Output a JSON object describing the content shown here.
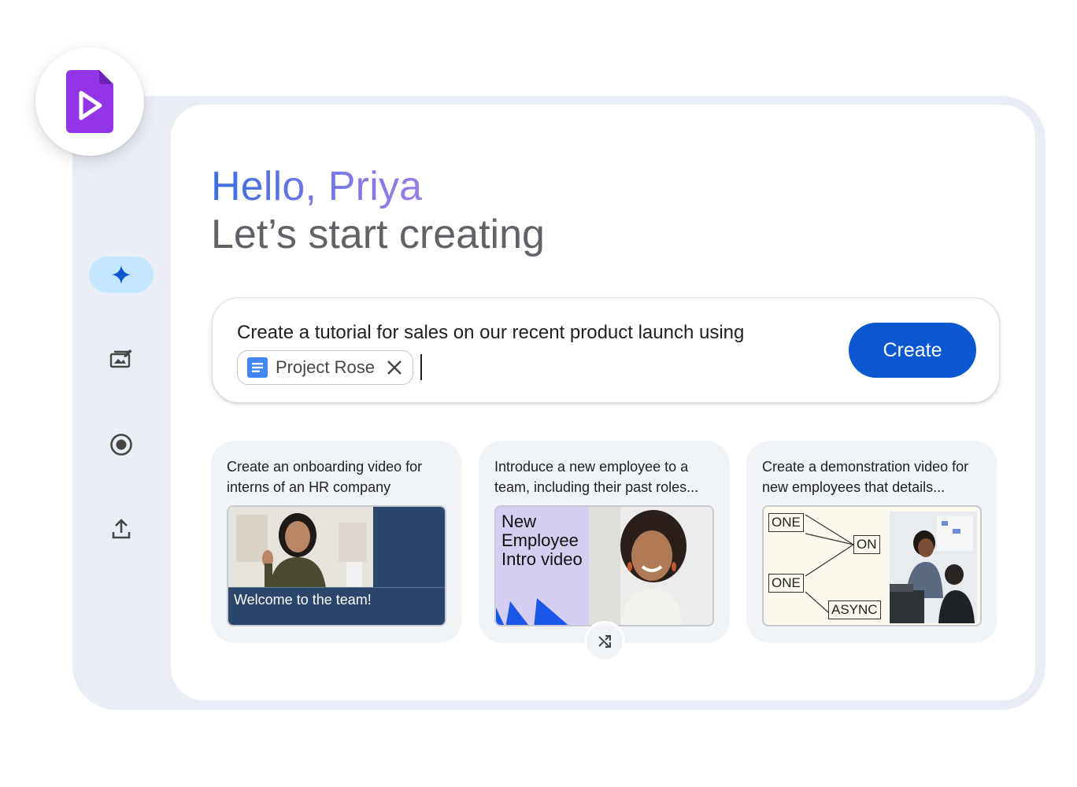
{
  "greeting": "Hello, Priya",
  "subtitle": "Let’s start creating",
  "prompt": {
    "text": "Create a tutorial for sales on our recent product launch using",
    "chip_label": "Project Rose",
    "create_label": "Create"
  },
  "rail": {
    "items": [
      {
        "name": "ai-create",
        "icon": "sparkle-icon",
        "active": true
      },
      {
        "name": "templates",
        "icon": "gallery-edit-icon",
        "active": false
      },
      {
        "name": "record",
        "icon": "record-icon",
        "active": false
      },
      {
        "name": "upload",
        "icon": "upload-icon",
        "active": false
      }
    ]
  },
  "cards": [
    {
      "description": "Create an onboarding video for interns of an HR company",
      "thumb_text": "Welcome to the team!"
    },
    {
      "description": "Introduce a new employee to a team, including their past roles...",
      "thumb_text": "New Employee Intro video"
    },
    {
      "description": "Create a demonstration video for new employees that details...",
      "diagram_labels": [
        "ONE",
        "ON",
        "ONE",
        "ASYNC"
      ]
    }
  ],
  "colors": {
    "brand_purple": "#9334e6",
    "primary_blue": "#0b57d0",
    "active_chip": "#c2e7ff",
    "card_bg": "#f0f4f9",
    "doc_blue": "#4285f4",
    "navy": "#2c466b"
  }
}
